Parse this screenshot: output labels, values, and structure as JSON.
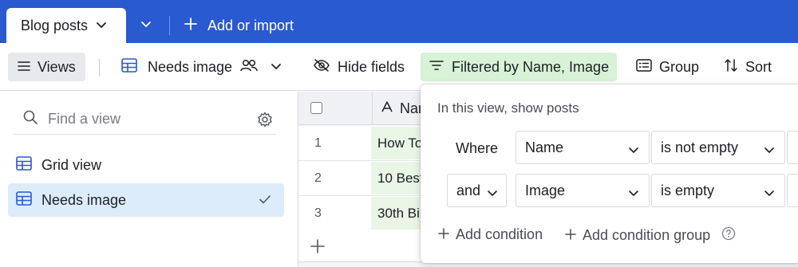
{
  "tabs": {
    "active_label": "Blog posts",
    "add_import_label": "Add or import"
  },
  "toolbar": {
    "views_label": "Views",
    "current_view_label": "Needs image",
    "hide_fields_label": "Hide fields",
    "filter_label": "Filtered by Name, Image",
    "group_label": "Group",
    "sort_label": "Sort"
  },
  "sidebar": {
    "search_placeholder": "Find a view",
    "views": [
      {
        "label": "Grid view",
        "active": false
      },
      {
        "label": "Needs image",
        "active": true
      }
    ]
  },
  "grid": {
    "name_column": "Name",
    "rows": [
      {
        "num": "1",
        "name": "How To"
      },
      {
        "num": "2",
        "name": "10 Best"
      },
      {
        "num": "3",
        "name": "30th Bi"
      }
    ]
  },
  "filter_popover": {
    "title": "In this view, show posts",
    "conditions": [
      {
        "conjunction": "Where",
        "field": "Name",
        "operator": "is not empty"
      },
      {
        "conjunction": "and",
        "field": "Image",
        "operator": "is empty"
      }
    ],
    "add_condition_label": "Add condition",
    "add_condition_group_label": "Add condition group"
  },
  "colors": {
    "brand_blue": "#2a5ad0",
    "filter_green": "#d7f2d6",
    "active_view_bg": "#dcecfa",
    "cell_green": "#e9f6e6"
  }
}
